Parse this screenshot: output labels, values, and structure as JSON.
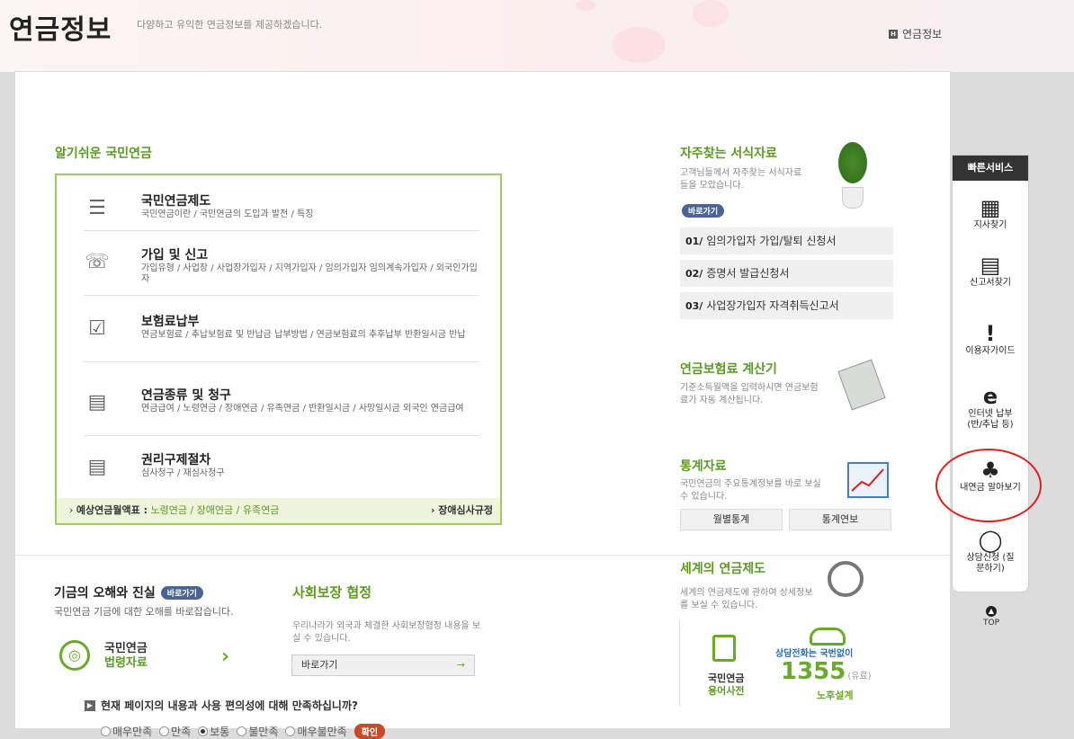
{
  "header": {
    "title": "연금정보",
    "subtitle": "다양하고 유익한 연금정보를 제공하겠습니다.",
    "breadcrumb": "연금정보"
  },
  "easy_pension": {
    "title": "알기쉬운 국민연금",
    "items": [
      {
        "icon": "document-list-icon",
        "title": "국민연금제도",
        "desc": "국민연금이란 / 국민연금의 도입과 발전 / 특징"
      },
      {
        "icon": "phone-chat-icon",
        "title": "가입 및 신고",
        "desc": "가입유형 / 사업장 / 사업장가입자 / 지역가입자 / 임의가입자 임의계속가입자 / 외국인가입자"
      },
      {
        "icon": "checkbox-icon",
        "title": "보험료납부",
        "desc": "연금보험료 / 추납보험료 및 반납금 납부방법 / 연금보험료의 추후납부 반환일시금 반납"
      },
      {
        "icon": "wallet-icon",
        "title": "연금종류 및 청구",
        "desc": "연금급여 / 노령연금 / 장애연금 / 유족연금 / 반환일시금 / 사망일시금 외국인 연금급여"
      },
      {
        "icon": "document-icon",
        "title": "권리구제절차",
        "desc": "심사청구 / 재심사청구"
      }
    ],
    "footer_label": "예상연금월액표 :",
    "footer_links": "노령연금 /  장애연금 /  유족연금",
    "footer_right": "장애심사규정"
  },
  "forms": {
    "title": "자주찾는 서식자료",
    "desc": "고객님들께서 자주찾는 서식자료들을 모았습니다.",
    "button": "바로가기",
    "items": [
      {
        "num": "01/",
        "label": "임의가입자 가입/탈퇴 신청서"
      },
      {
        "num": "02/",
        "label": "증명서 발급신청서"
      },
      {
        "num": "03/",
        "label": "사업장가입자 자격취득신고서"
      }
    ]
  },
  "calculator": {
    "title": "연금보험료 계산기",
    "desc": "기준소득월액을 입력하시면 연금보험료가 자동 계산됩니다."
  },
  "stats": {
    "title": "통계자료",
    "desc": "국민연금의 주요통계정보를 바로 보실 수 있습니다.",
    "buttons": [
      "월별통계",
      "통계연보"
    ]
  },
  "world": {
    "title": "세계의 연금제도",
    "desc": "세계의 연금제도에 관하여 상세정보를 보실 수 있습니다."
  },
  "fund": {
    "title": "기금의 오해와 진실",
    "button": "바로가기",
    "desc": "국민연금 기금에 대한 오해를 바로잡습니다."
  },
  "law": {
    "line1": "국민연금",
    "line2": "법령자료"
  },
  "social": {
    "title": "사회보장 협정",
    "desc": "우리나라가 외국과 체결한 사회보장협정 내용을 보실 수 있습니다.",
    "button": "바로가기"
  },
  "dictionary": {
    "line1": "국민연금",
    "line2": "용어사전"
  },
  "hotline": {
    "label": "상담전화는 국번없이",
    "number": "1355",
    "paid": "(유료)",
    "sub": "노후설계"
  },
  "survey": {
    "question": "현재 페이지의 내용과 사용 편의성에 대해 만족하십니까?",
    "options": [
      "매우만족",
      "만족",
      "보통",
      "불만족",
      "매우불만족"
    ],
    "selected": "보통",
    "confirm": "확인"
  },
  "quick": {
    "title": "빠른서비스",
    "items": [
      {
        "icon": "building-icon",
        "label": "지사찾기"
      },
      {
        "icon": "search-document-icon",
        "label": "신고서찾기"
      },
      {
        "icon": "guide-icon",
        "label": "이용자가이드"
      },
      {
        "icon": "internet-payment-icon",
        "label": "인터넷 납부 (반/추납 등)"
      },
      {
        "icon": "clover-icon",
        "label": "내연금 알아보기"
      },
      {
        "icon": "mouse-icon",
        "label": "상담신청 (질문하기)"
      }
    ],
    "top": "TOP"
  }
}
